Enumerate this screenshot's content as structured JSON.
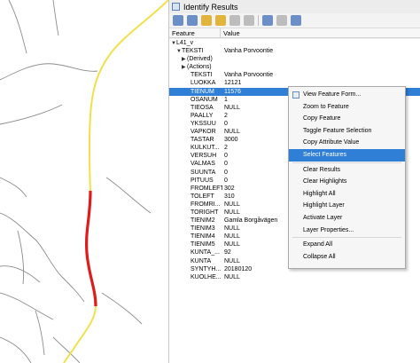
{
  "panel": {
    "title": "Identify Results",
    "toolbar_icons": [
      "expand-icon",
      "collapse-icon",
      "expand-new-icon",
      "clear-icon",
      "copy-icon",
      "print-icon",
      "settings-icon",
      "identify-mode-icon",
      "help-icon"
    ],
    "columns": {
      "feature": "Feature",
      "value": "Value"
    }
  },
  "tree": {
    "layer": "L41_v",
    "feature_key": "TEKSTI",
    "feature_val": "Vanha Porvoontie",
    "derived": "(Derived)",
    "actions": "(Actions)",
    "attributes": [
      {
        "k": "TEKSTI",
        "v": "Vanha Porvoontie"
      },
      {
        "k": "LUOKKA",
        "v": "12121"
      },
      {
        "k": "TIENUM",
        "v": "11576"
      },
      {
        "k": "OSANUM",
        "v": "1"
      },
      {
        "k": "TIEOSA",
        "v": "NULL"
      },
      {
        "k": "PAALLY",
        "v": "2"
      },
      {
        "k": "YKSSUU",
        "v": "0"
      },
      {
        "k": "VAPKOR",
        "v": "NULL"
      },
      {
        "k": "TASTAR",
        "v": "3000"
      },
      {
        "k": "KULKUT...",
        "v": "2"
      },
      {
        "k": "VERSUH",
        "v": "0"
      },
      {
        "k": "VALMAS",
        "v": "0"
      },
      {
        "k": "SUUNTA",
        "v": "0"
      },
      {
        "k": "PITUUS",
        "v": "0"
      },
      {
        "k": "FROMLEFT",
        "v": "302"
      },
      {
        "k": "TOLEFT",
        "v": "310"
      },
      {
        "k": "FROMRI...",
        "v": "NULL"
      },
      {
        "k": "TORIGHT",
        "v": "NULL"
      },
      {
        "k": "TIENIM2",
        "v": "Gamla Borgåvägen"
      },
      {
        "k": "TIENIM3",
        "v": "NULL"
      },
      {
        "k": "TIENIM4",
        "v": "NULL"
      },
      {
        "k": "TIENIM5",
        "v": "NULL"
      },
      {
        "k": "KUNTA_...",
        "v": "92"
      },
      {
        "k": "KUNTA",
        "v": "NULL"
      },
      {
        "k": "SYNTYH...",
        "v": "20180120"
      },
      {
        "k": "KUOLHE...",
        "v": "NULL"
      }
    ]
  },
  "context_menu": {
    "items": [
      {
        "label": "View Feature Form...",
        "icon": "form-icon"
      },
      {
        "label": "Zoom to Feature",
        "icon": ""
      },
      {
        "label": "Copy Feature",
        "icon": ""
      },
      {
        "label": "Toggle Feature Selection",
        "icon": ""
      },
      {
        "label": "Copy Attribute Value",
        "icon": ""
      },
      {
        "label": "Select Features",
        "icon": ""
      },
      {
        "label": "Clear Results",
        "icon": ""
      },
      {
        "label": "Clear Highlights",
        "icon": ""
      },
      {
        "label": "Highlight All",
        "icon": ""
      },
      {
        "label": "Highlight Layer",
        "icon": ""
      },
      {
        "label": "Activate Layer",
        "icon": ""
      },
      {
        "label": "Layer Properties...",
        "icon": ""
      },
      {
        "label": "Expand All",
        "icon": ""
      },
      {
        "label": "Collapse All",
        "icon": ""
      }
    ],
    "highlighted_index": 5
  },
  "colors": {
    "selection": "#2f7fd6",
    "road_yellow": "#f2e04a",
    "road_red": "#e01b1b",
    "map_lines": "#8c8c8c"
  }
}
